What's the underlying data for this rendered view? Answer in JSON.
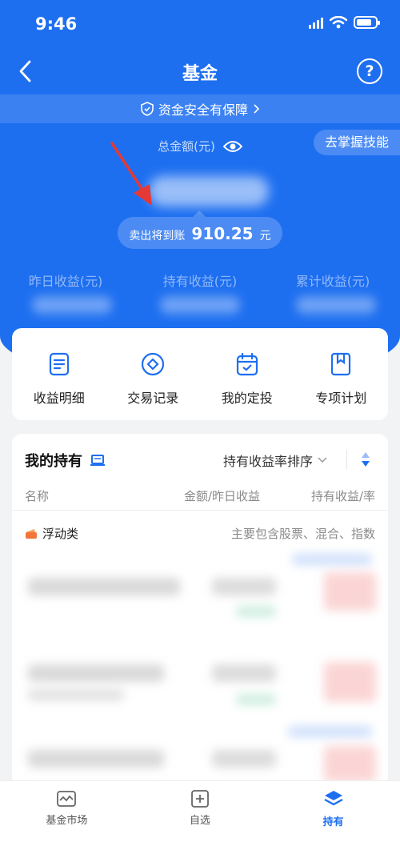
{
  "status_bar": {
    "time": "9:46"
  },
  "nav": {
    "title": "基金",
    "help": "?"
  },
  "safety": {
    "text": "资金安全有保障"
  },
  "summary": {
    "total_label": "总金额(元)",
    "learn_button": "去掌握技能",
    "sell_label": "卖出将到账",
    "sell_amount": "910.25",
    "sell_unit": "元"
  },
  "earnings": {
    "yesterday_label": "昨日收益(元)",
    "holding_label": "持有收益(元)",
    "total_label": "累计收益(元)"
  },
  "quick_actions": [
    {
      "label": "收益明细",
      "icon": "document-icon"
    },
    {
      "label": "交易记录",
      "icon": "diamond-circle-icon"
    },
    {
      "label": "我的定投",
      "icon": "calendar-check-icon"
    },
    {
      "label": "专项计划",
      "icon": "bookmark-icon"
    }
  ],
  "holdings": {
    "title": "我的持有",
    "sort_label": "持有收益率排序",
    "columns": {
      "name": "名称",
      "amount": "金额/昨日收益",
      "yield": "持有收益/率"
    },
    "category": {
      "name": "浮动类",
      "desc": "主要包含股票、混合、指数"
    }
  },
  "tabbar": [
    {
      "label": "基金市场",
      "icon": "market-icon"
    },
    {
      "label": "自选",
      "icon": "add-watchlist-icon"
    },
    {
      "label": "持有",
      "icon": "layers-icon",
      "active": true
    }
  ],
  "colors": {
    "primary": "#1e6ff0",
    "arrow": "#e53935"
  }
}
